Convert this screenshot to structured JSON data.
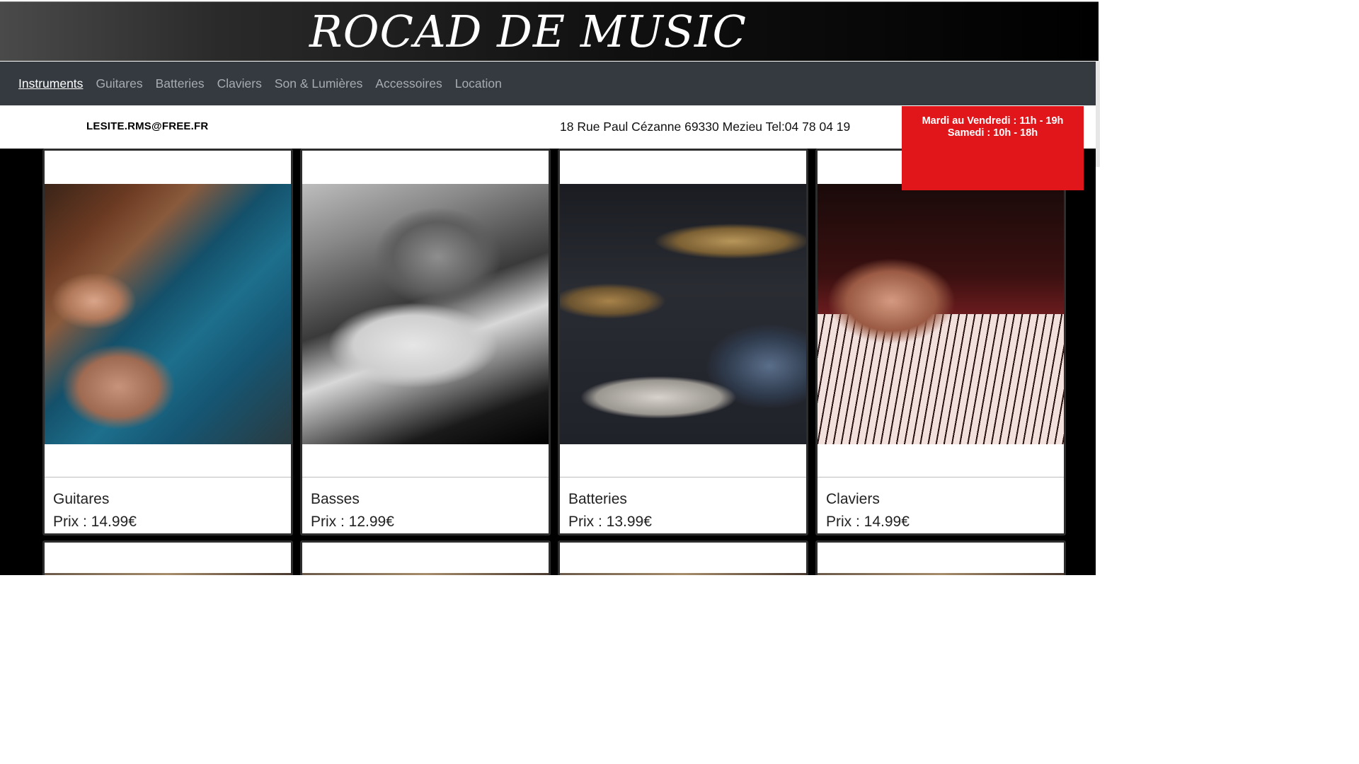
{
  "header": {
    "title": "ROCAD DE MUSIC"
  },
  "nav": {
    "items": [
      {
        "label": "Instruments",
        "active": true
      },
      {
        "label": "Guitares"
      },
      {
        "label": "Batteries"
      },
      {
        "label": "Claviers"
      },
      {
        "label": "Son & Lumières"
      },
      {
        "label": "Accessoires"
      },
      {
        "label": "Location"
      }
    ]
  },
  "info": {
    "email": "LESITE.RMS@FREE.FR",
    "address": "18 Rue Paul Cézanne 69330 Mezieu Tel:04 78 04 19",
    "hours_line1": "Mardi au Vendredi : 11h - 19h",
    "hours_line2": "Samedi : 10h - 18h"
  },
  "products": [
    {
      "name": "Guitares",
      "price": "Prix : 14.99€",
      "image": "electric-guitar-photo"
    },
    {
      "name": "Basses",
      "price": "Prix : 12.99€",
      "image": "bass-guitar-photo"
    },
    {
      "name": "Batteries",
      "price": "Prix : 13.99€",
      "image": "drum-kit-photo"
    },
    {
      "name": "Claviers",
      "price": "Prix : 14.99€",
      "image": "keyboard-photo"
    }
  ],
  "colors": {
    "header_bg": "#111111",
    "nav_bg": "#343a40",
    "hours_bg": "#e0161b",
    "products_bg": "#000000"
  }
}
